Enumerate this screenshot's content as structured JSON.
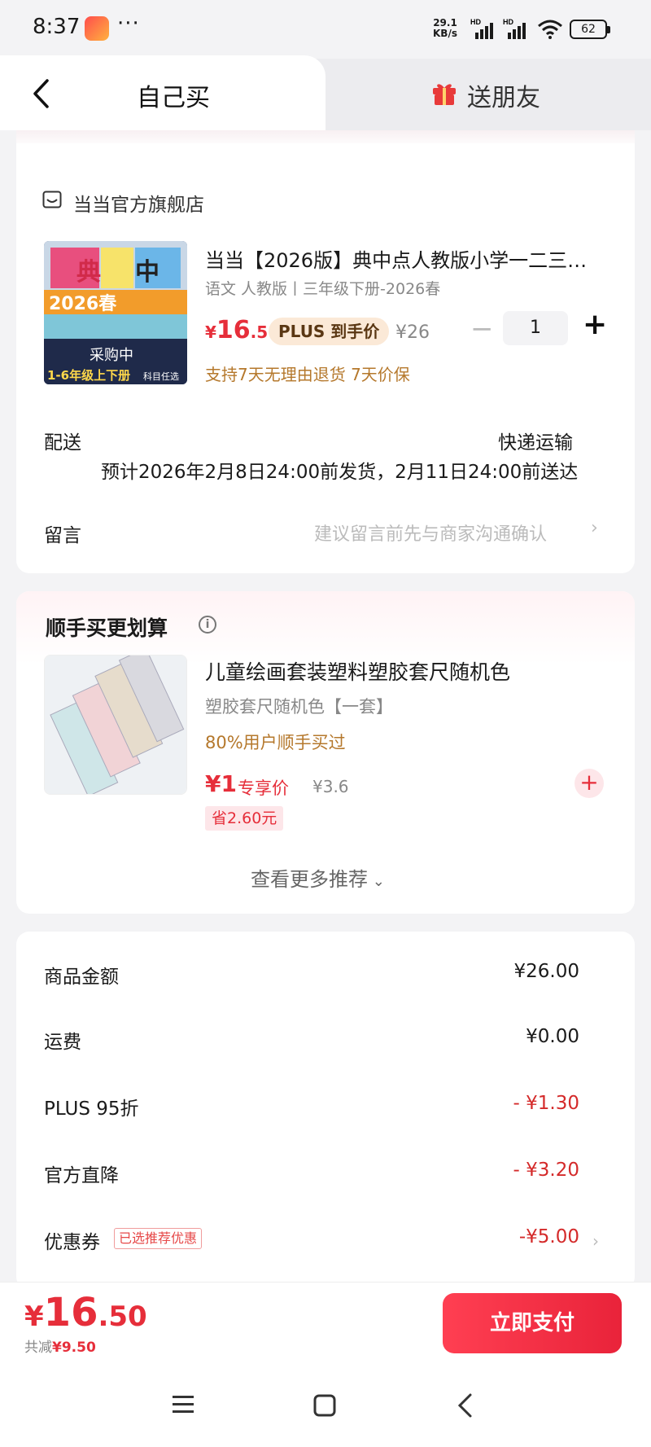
{
  "status_bar": {
    "time": "8:37",
    "dots": "···",
    "net_speed": "29.1",
    "net_unit": "KB/s",
    "hd1": "HD",
    "hd2": "HD",
    "battery": "62"
  },
  "tabs": {
    "self": "自己买",
    "friend": "送朋友"
  },
  "shop": {
    "name": "当当官方旗舰店"
  },
  "product": {
    "title": "当当【2026版】典中点人教版小学一二三…",
    "spec": "语文 人教版丨三年级下册-2026春",
    "price_symbol": "¥",
    "price_int": "16",
    "price_dec": ".5",
    "plus_label": "PLUS 到手价",
    "orig_price": "¥26",
    "qty": "1",
    "services": "支持7天无理由退货  7天价保",
    "cover_text1": "2026春",
    "cover_text2": "采购中",
    "cover_text3": "1-6年级上下册",
    "cover_text4": "科目任选"
  },
  "delivery": {
    "label": "配送",
    "method": "快递运输",
    "estimate": "预计2026年2月8日24:00前发货，2月11日24:00前送达"
  },
  "message": {
    "label": "留言",
    "placeholder": "建议留言前先与商家沟通确认"
  },
  "recommend": {
    "title": "顺手买更划算",
    "item_title": "儿童绘画套装塑料塑胶套尺随机色",
    "item_spec": "塑胶套尺随机色【一套】",
    "item_buy": "80%用户顺手买过",
    "item_price": "¥1",
    "item_price_label": "专享价",
    "item_orig": "¥3.6",
    "item_save": "省2.60元",
    "more": "查看更多推荐"
  },
  "summary": {
    "rows": [
      {
        "label": "商品金额",
        "value": "¥26.00"
      },
      {
        "label": "运费",
        "value": "¥0.00"
      },
      {
        "label": "PLUS 95折",
        "value": "- ¥1.30"
      },
      {
        "label": "官方直降",
        "value": "- ¥3.20"
      },
      {
        "label": "优惠券",
        "value": "-¥5.00"
      }
    ],
    "coupon_tag": "已选推荐优惠"
  },
  "footer": {
    "currency": "¥",
    "total_int": "16",
    "total_dec": ".50",
    "saved_label": "共减",
    "saved_value": "¥9.50",
    "pay": "立即支付"
  },
  "colors": {
    "accent": "#e62e3a",
    "gold": "#b5782c"
  }
}
